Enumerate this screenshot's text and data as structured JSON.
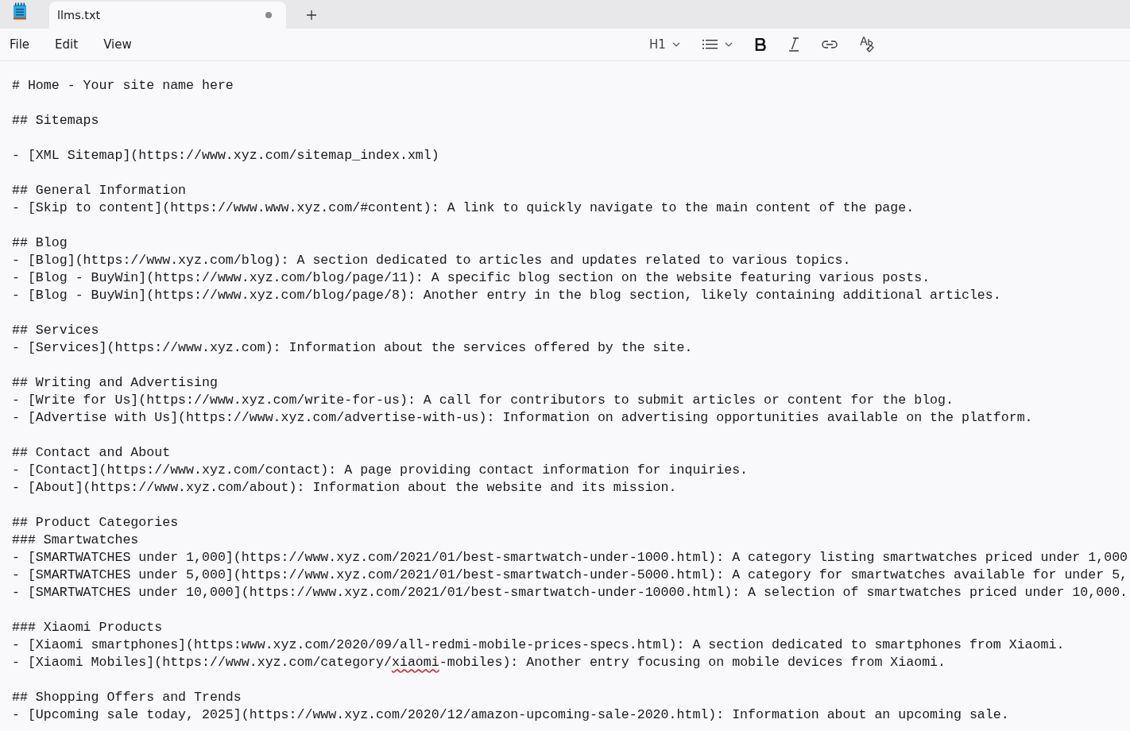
{
  "tab": {
    "title": "llms.txt",
    "modified": true
  },
  "menu": [
    "File",
    "Edit",
    "View"
  ],
  "toolbar": {
    "heading": "H1"
  },
  "blocks": [
    [
      {
        "text": "# Home - Your site name here"
      }
    ],
    [
      {
        "text": "## Sitemaps"
      }
    ],
    [
      {
        "text": "- [XML Sitemap](https://www.xyz.com/sitemap_index.xml)"
      }
    ],
    [
      {
        "text": "## General Information"
      },
      {
        "text": "- [Skip to content](https://www.www.xyz.com/#content): A link to quickly navigate to the main content of the page."
      }
    ],
    [
      {
        "text": "## Blog"
      },
      {
        "text": "- [Blog](https://www.xyz.com/blog): A section dedicated to articles and updates related to various topics."
      },
      {
        "text": "- [Blog - BuyWin](https://www.xyz.com/blog/page/11): A specific blog section on the website featuring various posts."
      },
      {
        "text": "- [Blog - BuyWin](https://www.xyz.com/blog/page/8): Another entry in the blog section, likely containing additional articles."
      }
    ],
    [
      {
        "text": "## Services"
      },
      {
        "text": "- [Services](https://www.xyz.com): Information about the services offered by the site."
      }
    ],
    [
      {
        "text": "## Writing and Advertising"
      },
      {
        "text": "- [Write for Us](https://www.xyz.com/write-for-us): A call for contributors to submit articles or content for the blog."
      },
      {
        "text": "- [Advertise with Us](https://www.xyz.com/advertise-with-us): Information on advertising opportunities available on the platform."
      }
    ],
    [
      {
        "text": "## Contact and About"
      },
      {
        "text": "- [Contact](https://www.xyz.com/contact): A page providing contact information for inquiries."
      },
      {
        "text": "- [About](https://www.xyz.com/about): Information about the website and its mission."
      }
    ],
    [
      {
        "text": "## Product Categories"
      },
      {
        "text": "### Smartwatches"
      },
      {
        "text": "- [SMARTWATCHES under 1,000](https://www.xyz.com/2021/01/best-smartwatch-under-1000.html): A category listing smartwatches priced under 1,000"
      },
      {
        "text": "- [SMARTWATCHES under 5,000](https://www.xyz.com/2021/01/best-smartwatch-under-5000.html): A category for smartwatches available for under 5,"
      },
      {
        "text": "- [SMARTWATCHES under 10,000](https://www.xyz.com/2021/01/best-smartwatch-under-10000.html): A selection of smartwatches priced under 10,000."
      }
    ],
    [
      {
        "text": "### Xiaomi Products"
      },
      {
        "text": "- [Xiaomi smartphones](https:www.xyz.com/2020/09/all-redmi-mobile-prices-specs.html): A section dedicated to smartphones from Xiaomi."
      },
      {
        "parts": [
          {
            "text": "- [Xiaomi Mobiles](https://www.xyz.com/category/",
            "misspelled": false
          },
          {
            "text": "xiaomi",
            "misspelled": true
          },
          {
            "text": "-mobiles): Another entry focusing on mobile devices from Xiaomi.",
            "misspelled": false
          }
        ]
      }
    ],
    [
      {
        "text": "## Shopping Offers and Trends"
      },
      {
        "text": "- [Upcoming sale today, 2025](https://www.xyz.com/2020/12/amazon-upcoming-sale-2020.html): Information about an upcoming sale."
      }
    ]
  ]
}
